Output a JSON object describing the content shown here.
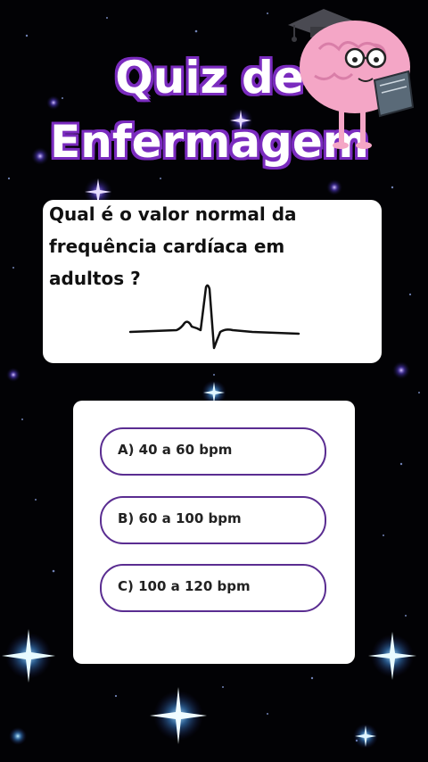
{
  "title": {
    "line1": "Quiz de",
    "line2": "Enfermagem"
  },
  "question": {
    "text": "Qual é o valor normal da frequência cardíaca em adultos ?"
  },
  "options": [
    {
      "label": "A) 40 a 60 bpm"
    },
    {
      "label": "B) 60 a 100 bpm"
    },
    {
      "label": "C) 100 a 120 bpm"
    }
  ],
  "colors": {
    "background": "#020205",
    "accent_purple": "#7b2cbf",
    "option_border": "#5a2d91",
    "card": "#ffffff",
    "mascot_pink": "#f4a6c6",
    "star_blue": "#7fd8ff"
  },
  "icons": {
    "mascot": "brain-mascot-icon",
    "ecg": "heartbeat-ecg-icon"
  }
}
